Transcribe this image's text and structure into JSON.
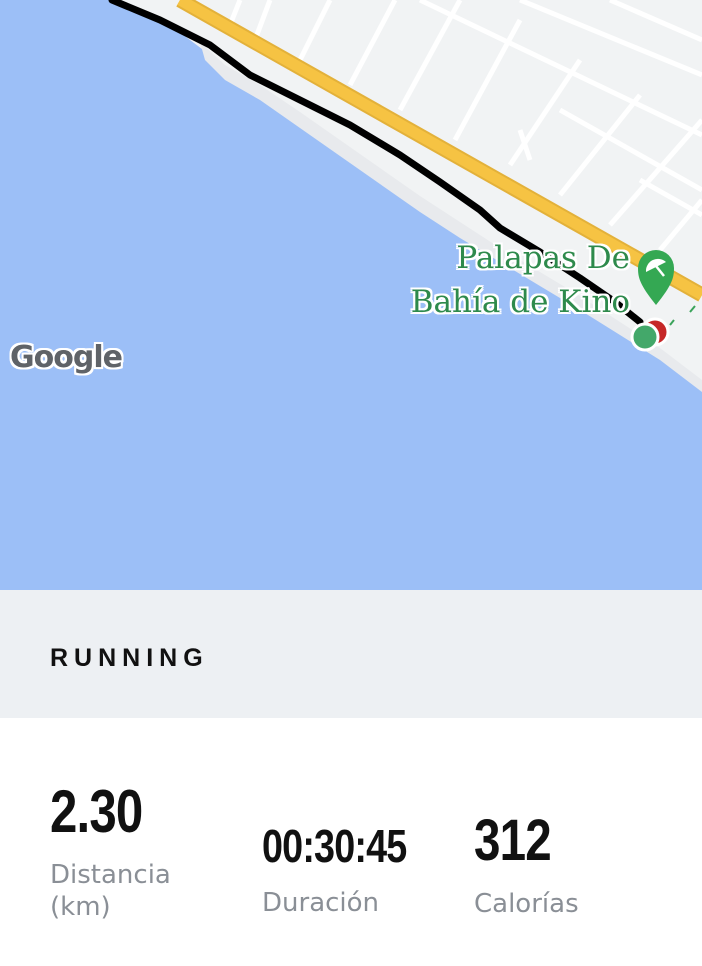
{
  "map": {
    "poi": {
      "name_line1": "Palapas De",
      "name_line2": "Bahía de Kino",
      "icon": "beach-umbrella-icon",
      "color": "#2e8a4c"
    },
    "attribution": "Google",
    "colors": {
      "water": "#9cbff7",
      "land": "#f1f3f4",
      "highway": "#f6c343",
      "route": "#000000"
    }
  },
  "activity": {
    "type": "RUNNING"
  },
  "stats": {
    "distance": {
      "value": "2.30",
      "label_line1": "Distancia",
      "label_line2": "(km)"
    },
    "duration": {
      "value": "00:30:45",
      "label": "Duración"
    },
    "calories": {
      "value": "312",
      "label": "Calorías"
    }
  }
}
